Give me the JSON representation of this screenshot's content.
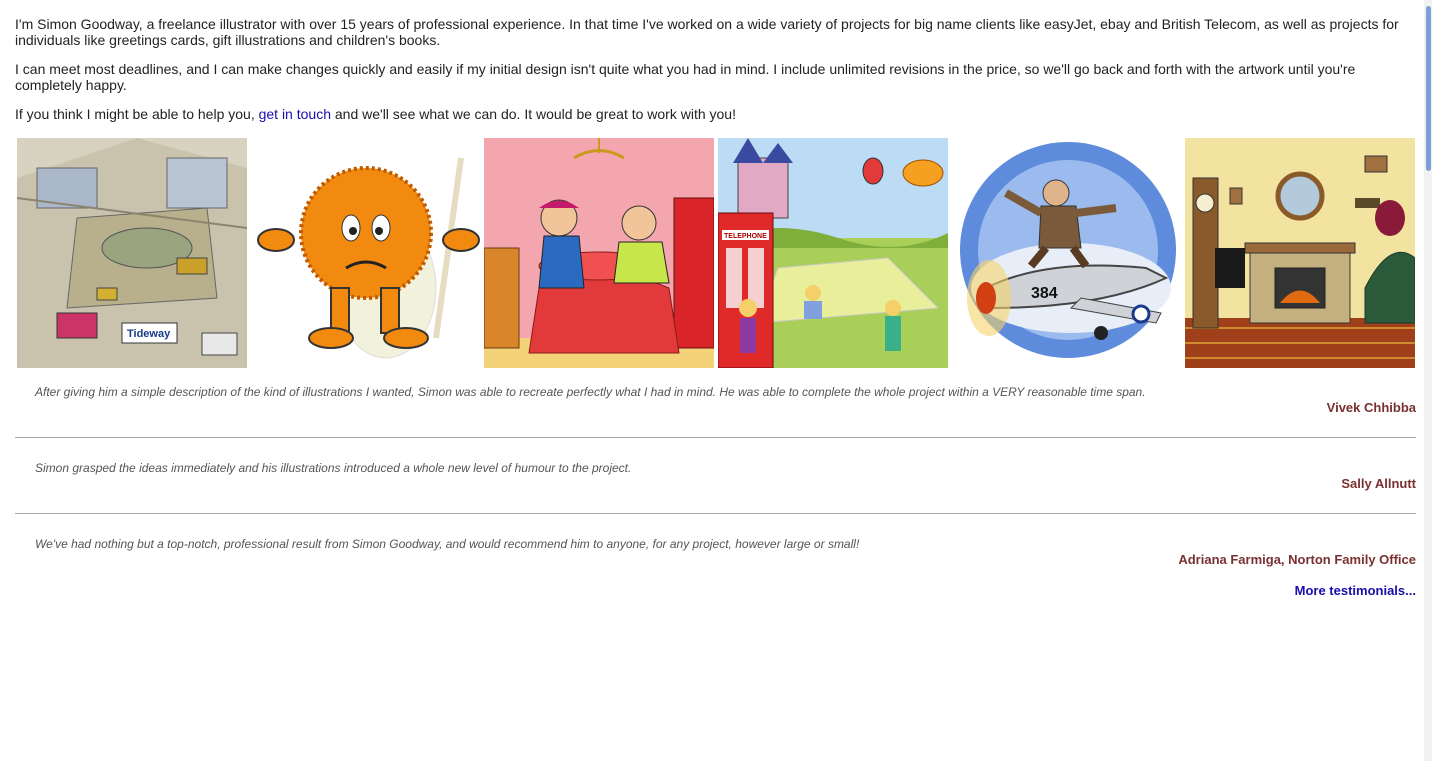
{
  "intro": {
    "p1": "I'm Simon Goodway, a freelance illustrator with over 15 years of professional experience. In that time I've worked on a wide variety of projects for big name clients like easyJet, ebay and British Telecom, as well as projects for individuals like greetings cards, gift illustrations and children's books.",
    "p2": "I can meet most deadlines, and I can make changes quickly and easily if my initial design isn't quite what you had in mind. I include unlimited revisions in the price, so we'll go back and forth with the artwork until you're completely happy.",
    "p3_before": "If you think I might be able to help you, ",
    "p3_link": "get in touch",
    "p3_after": " and we'll see what we can do. It would be great to work with you!"
  },
  "gallery": {
    "images": [
      {
        "name": "construction-site-illustration",
        "sign_text": "Tideway"
      },
      {
        "name": "orange-fuzzy-character-illustration"
      },
      {
        "name": "fortune-teller-couple-illustration"
      },
      {
        "name": "fairground-park-illustration",
        "sign_text": "TELEPHONE"
      },
      {
        "name": "pilot-on-plane-illustration",
        "plane_number": "384"
      },
      {
        "name": "living-room-fireplace-illustration"
      }
    ]
  },
  "testimonials": [
    {
      "quote": "After giving him a simple description of the kind of illustrations I wanted, Simon was able to recreate perfectly what I had in mind. He was able to complete the whole project within a VERY reasonable time span.",
      "author": "Vivek Chhibba"
    },
    {
      "quote": "Simon grasped the ideas immediately and his illustrations introduced a whole new level of humour to the project.",
      "author": "Sally Allnutt"
    },
    {
      "quote": "We've had nothing but a top-notch, professional result from Simon Goodway, and would recommend him to anyone, for any project, however large or small!",
      "author": "Adriana Farmiga, Norton Family Office"
    }
  ],
  "more_link": "More testimonials...",
  "colors": {
    "link": "#1a0dab",
    "author": "#7a3030",
    "quote": "#555555",
    "scrollbar_thumb": "#7f9ed6"
  }
}
